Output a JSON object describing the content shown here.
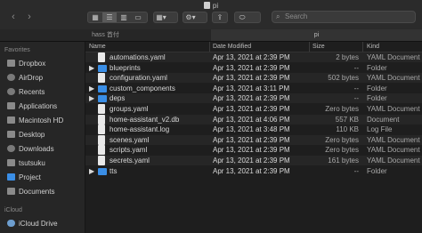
{
  "window": {
    "title": "pi",
    "search_placeholder": "Search"
  },
  "tabs": [
    {
      "label": "hass 首付",
      "active": false
    },
    {
      "label": "pi",
      "active": true
    }
  ],
  "sidebar": {
    "favorites_header": "Favorites",
    "favorites": [
      {
        "label": "Dropbox",
        "icon": "dropbox-icon"
      },
      {
        "label": "AirDrop",
        "icon": "airdrop-icon"
      },
      {
        "label": "Recents",
        "icon": "recents-icon"
      },
      {
        "label": "Applications",
        "icon": "applications-icon"
      },
      {
        "label": "Macintosh HD",
        "icon": "drive-icon"
      },
      {
        "label": "Desktop",
        "icon": "desktop-icon"
      },
      {
        "label": "Downloads",
        "icon": "downloads-icon"
      },
      {
        "label": "tsutsuku",
        "icon": "home-icon"
      },
      {
        "label": "Project",
        "icon": "folder-icon"
      },
      {
        "label": "Documents",
        "icon": "documents-icon"
      }
    ],
    "icloud_header": "iCloud",
    "icloud": [
      {
        "label": "iCloud Drive",
        "icon": "icloud-icon"
      }
    ]
  },
  "columns": {
    "name": "Name",
    "date": "Date Modified",
    "size": "Size",
    "kind": "Kind"
  },
  "files": [
    {
      "name": "automations.yaml",
      "date": "Apr 13, 2021 at 2:39 PM",
      "size": "2 bytes",
      "kind": "YAML Document",
      "folder": false
    },
    {
      "name": "blueprints",
      "date": "Apr 13, 2021 at 2:39 PM",
      "size": "--",
      "kind": "Folder",
      "folder": true
    },
    {
      "name": "configuration.yaml",
      "date": "Apr 13, 2021 at 2:39 PM",
      "size": "502 bytes",
      "kind": "YAML Document",
      "folder": false
    },
    {
      "name": "custom_components",
      "date": "Apr 13, 2021 at 3:11 PM",
      "size": "--",
      "kind": "Folder",
      "folder": true
    },
    {
      "name": "deps",
      "date": "Apr 13, 2021 at 2:39 PM",
      "size": "--",
      "kind": "Folder",
      "folder": true
    },
    {
      "name": "groups.yaml",
      "date": "Apr 13, 2021 at 2:39 PM",
      "size": "Zero bytes",
      "kind": "YAML Document",
      "folder": false
    },
    {
      "name": "home-assistant_v2.db",
      "date": "Apr 13, 2021 at 4:06 PM",
      "size": "557 KB",
      "kind": "Document",
      "folder": false
    },
    {
      "name": "home-assistant.log",
      "date": "Apr 13, 2021 at 3:48 PM",
      "size": "110 KB",
      "kind": "Log File",
      "folder": false
    },
    {
      "name": "scenes.yaml",
      "date": "Apr 13, 2021 at 2:39 PM",
      "size": "Zero bytes",
      "kind": "YAML Document",
      "folder": false
    },
    {
      "name": "scripts.yaml",
      "date": "Apr 13, 2021 at 2:39 PM",
      "size": "Zero bytes",
      "kind": "YAML Document",
      "folder": false
    },
    {
      "name": "secrets.yaml",
      "date": "Apr 13, 2021 at 2:39 PM",
      "size": "161 bytes",
      "kind": "YAML Document",
      "folder": false
    },
    {
      "name": "tts",
      "date": "Apr 13, 2021 at 2:39 PM",
      "size": "--",
      "kind": "Folder",
      "folder": true
    }
  ]
}
